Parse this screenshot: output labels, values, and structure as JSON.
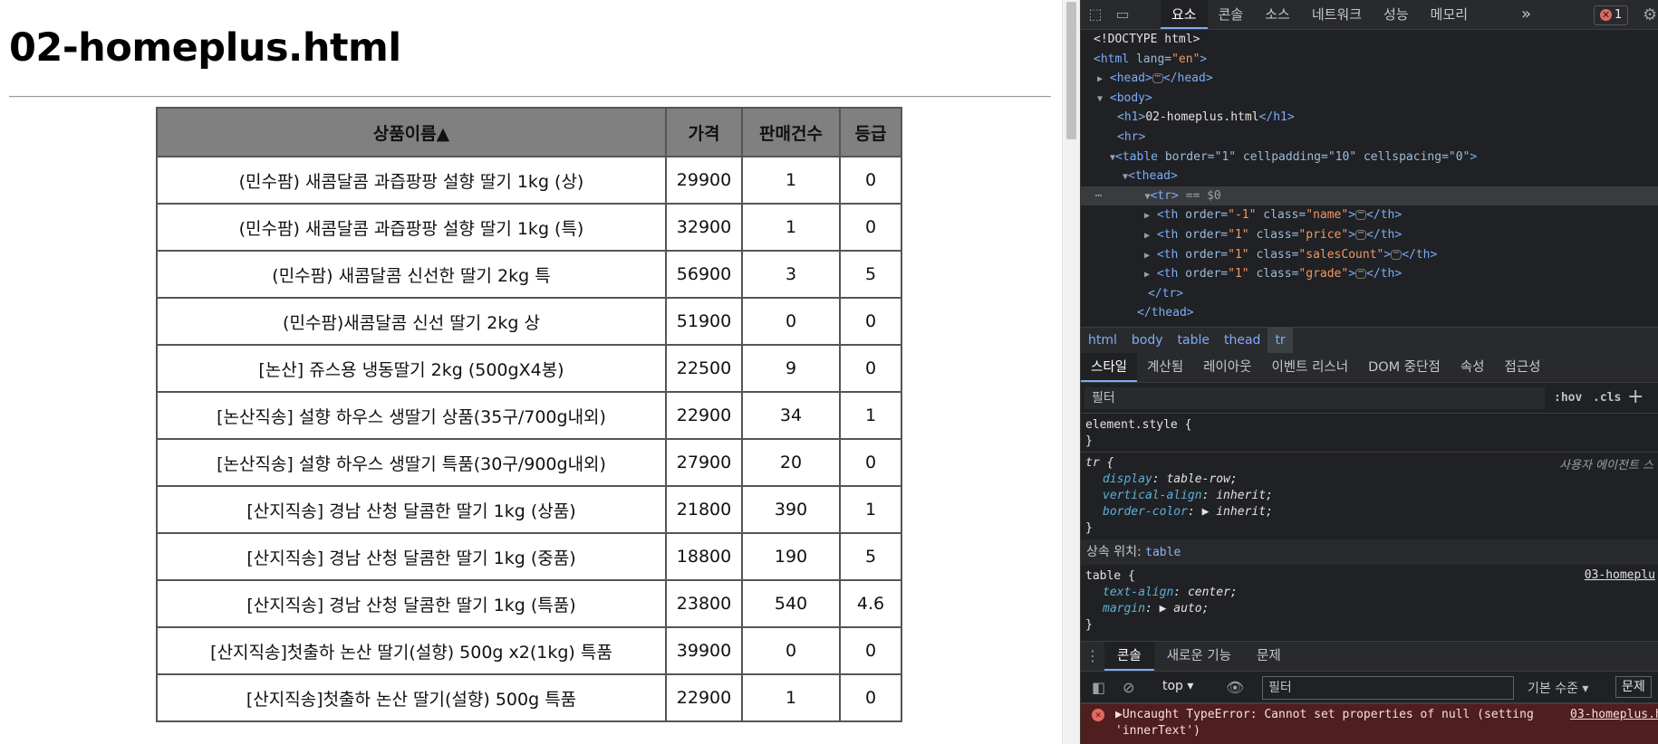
{
  "page": {
    "heading": "02-homeplus.html",
    "table": {
      "headers": [
        "상품이름▲",
        "가격",
        "판매건수",
        "등급"
      ],
      "rows": [
        [
          "(민수팜) 새콤달콤 과즙팡팡 설향 딸기 1kg (상)",
          "29900",
          "1",
          "0"
        ],
        [
          "(민수팜) 새콤달콤 과즙팡팡 설향 딸기 1kg (특)",
          "32900",
          "1",
          "0"
        ],
        [
          "(민수팜) 새콤달콤 신선한 딸기 2kg 특",
          "56900",
          "3",
          "5"
        ],
        [
          "(민수팜)새콤달콤 신선 딸기 2kg 상",
          "51900",
          "0",
          "0"
        ],
        [
          "[논산] 쥬스용 냉동딸기 2kg (500gX4봉)",
          "22500",
          "9",
          "0"
        ],
        [
          "[논산직송] 설향 하우스 생딸기 상품(35구/700g내외)",
          "22900",
          "34",
          "1"
        ],
        [
          "[논산직송] 설향 하우스 생딸기 특품(30구/900g내외)",
          "27900",
          "20",
          "0"
        ],
        [
          "[산지직송] 경남 산청 달콤한 딸기 1kg (상품)",
          "21800",
          "390",
          "1"
        ],
        [
          "[산지직송] 경남 산청 달콤한 딸기 1kg (중품)",
          "18800",
          "190",
          "5"
        ],
        [
          "[산지직송] 경남 산청 달콤한 딸기 1kg (특품)",
          "23800",
          "540",
          "4.6"
        ],
        [
          "[산지직송]첫출하 논산 딸기(설향) 500g x2(1kg) 특품",
          "39900",
          "0",
          "0"
        ],
        [
          "[산지직송]첫출하 논산 딸기(설향) 500g 특품",
          "22900",
          "1",
          "0"
        ]
      ]
    }
  },
  "devtools": {
    "main_tabs": [
      "요소",
      "콘솔",
      "소스",
      "네트워크",
      "성능",
      "메모리"
    ],
    "active_tab": "요소",
    "more_tabs": "»",
    "error_count": "1",
    "dom": {
      "doctype": "<!DOCTYPE html>",
      "html_open_tag": "<html",
      "html_lang_attr": " lang=",
      "html_lang_val": "\"en\"",
      "head": "head",
      "body": "body",
      "h1_text": "02-homeplus.html",
      "hr": "<hr>",
      "table_attrs": " border=\"1\" cellpadding=\"10\" cellspacing=\"0\"",
      "thead": "thead",
      "tr_selected_suffix": " == $0",
      "th_rows": [
        {
          "order": "\"-1\"",
          "class": "\"name\""
        },
        {
          "order": "\"1\"",
          "class": "\"price\""
        },
        {
          "order": "\"1\"",
          "class": "\"salesCount\""
        },
        {
          "order": "\"1\"",
          "class": "\"grade\""
        }
      ]
    },
    "breadcrumbs": [
      "html",
      "body",
      "table",
      "thead",
      "tr"
    ],
    "sub_tabs": [
      "스타일",
      "계산됨",
      "레이아웃",
      "이벤트 리스너",
      "DOM 중단점",
      "속성",
      "접근성"
    ],
    "styles_filter_placeholder": "필터",
    "hov": ":hov",
    "cls": ".cls",
    "styles": {
      "element_style": "element.style {",
      "close_brace": "}",
      "tr_selector": "tr {",
      "ua_label": "사용자 에이전트 스",
      "tr_props": [
        {
          "name": "display",
          "value": "table-row;"
        },
        {
          "name": "vertical-align",
          "value": "inherit;"
        },
        {
          "name": "border-color",
          "value": "▶ inherit;"
        }
      ],
      "inherited_label": "상속 위치: ",
      "inherited_from": "table",
      "table_selector": "table {",
      "table_source": "03-homeplu",
      "table_props": [
        {
          "name": "text-align",
          "value": "center;"
        },
        {
          "name": "margin",
          "value": "▶ auto;"
        }
      ]
    },
    "drawer_tabs": [
      "콘솔",
      "새로운 기능",
      "문제"
    ],
    "console": {
      "context": "top",
      "filter_placeholder": "필터",
      "level": "기본 수준",
      "issues_label": "문제",
      "error_line1": "▶Uncaught TypeError: Cannot set properties of null (setting",
      "error_line2": "'innerText')",
      "error_source": "03-homeplus.h"
    }
  }
}
